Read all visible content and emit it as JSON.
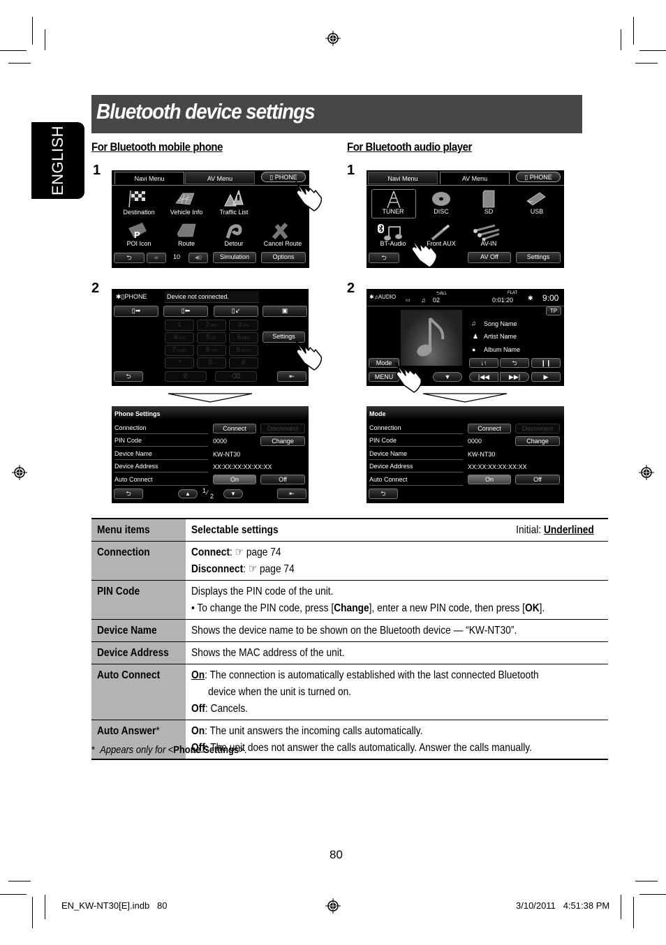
{
  "page": {
    "title": "Bluetooth device settings",
    "language_tab": "ENGLISH",
    "page_number": "80",
    "footer_left": "EN_KW-NT30[E].indb   80",
    "footer_right": "3/10/2011   4:51:38 PM",
    "colors": {
      "title_bar": "#474747",
      "menu_column": "#b3b3b3",
      "screen_bg": "#000000"
    }
  },
  "phone_section": {
    "heading": "For Bluetooth mobile phone",
    "step1": "1",
    "step2": "2",
    "navi_screen": {
      "tabs": [
        "Navi Menu",
        "AV Menu",
        "PHONE"
      ],
      "icons": [
        {
          "label": "Destination",
          "icon": "checkered-flag-icon"
        },
        {
          "label": "Vehicle Info",
          "icon": "map-pin-icon"
        },
        {
          "label": "Traffic List",
          "icon": "traffic-sign-icon"
        },
        {
          "label": "POI Icon",
          "icon": "poi-icon"
        },
        {
          "label": "Route",
          "icon": "route-map-icon"
        },
        {
          "label": "Detour",
          "icon": "detour-icon"
        },
        {
          "label": "Cancel Route",
          "icon": "cancel-route-icon"
        }
      ],
      "volume_value": "10",
      "bottom_buttons": [
        "Simulation",
        "Options"
      ]
    },
    "phone_screen": {
      "header": "PHONE",
      "status": "Device not connected.",
      "keypad": [
        [
          "1",
          ""
        ],
        [
          "2",
          "ABC"
        ],
        [
          "3",
          "DEF"
        ],
        [
          "4",
          "GHI"
        ],
        [
          "5",
          "JKL"
        ],
        [
          "6",
          "MNO"
        ],
        [
          "7",
          "PQRS"
        ],
        [
          "8",
          "TUV"
        ],
        [
          "9",
          "WXYZ"
        ],
        [
          "*",
          ""
        ],
        [
          "0",
          "+"
        ],
        [
          "#",
          ""
        ]
      ],
      "settings_button": "Settings"
    },
    "settings_screen": {
      "title": "Phone Settings",
      "rows": [
        {
          "label": "Connection"
        },
        {
          "label": "PIN Code",
          "value": "0000"
        },
        {
          "label": "Device Name",
          "value": "KW-NT30"
        },
        {
          "label": "Device Address",
          "value": "XX:XX:XX:XX:XX:XX"
        },
        {
          "label": "Auto Connect"
        }
      ],
      "connect": "Connect",
      "disconnect": "Disconnect",
      "change": "Change",
      "on": "On",
      "off": "Off",
      "page_current": "1",
      "page_total": "2"
    }
  },
  "audio_section": {
    "heading": "For Bluetooth audio player",
    "step1": "1",
    "step2": "2",
    "av_screen": {
      "tabs": [
        "Navi Menu",
        "AV Menu",
        "PHONE"
      ],
      "icons": [
        {
          "label": "TUNER",
          "icon": "antenna-tower-icon"
        },
        {
          "label": "DISC",
          "icon": "disc-icon"
        },
        {
          "label": "SD",
          "icon": "sd-card-icon"
        },
        {
          "label": "USB",
          "icon": "usb-drive-icon"
        },
        {
          "label": "BT-Audio",
          "icon": "bluetooth-music-icon"
        },
        {
          "label": "Front AUX",
          "icon": "aux-plug-icon"
        },
        {
          "label": "AV-IN",
          "icon": "rca-cable-icon"
        }
      ],
      "bottom_buttons": [
        "AV Off",
        "Settings"
      ]
    },
    "audio_screen": {
      "header": "AUDIO",
      "repeat_mode": "ALL",
      "track": "02",
      "eq": "FLAT",
      "elapsed": "0:01:20",
      "clock": "9:00",
      "tp": "TP",
      "song": "Song Name",
      "artist": "Artist Name",
      "album": "Album Name",
      "mode_button": "Mode",
      "menu_button": "MENU"
    },
    "settings_screen": {
      "title": "Mode",
      "rows": [
        {
          "label": "Connection"
        },
        {
          "label": "PIN Code",
          "value": "0000"
        },
        {
          "label": "Device Name",
          "value": "KW-NT30"
        },
        {
          "label": "Device Address",
          "value": "XX:XX:XX:XX:XX:XX"
        },
        {
          "label": "Auto Connect"
        }
      ],
      "connect": "Connect",
      "disconnect": "Disconnect",
      "change": "Change",
      "on": "On",
      "off": "Off"
    }
  },
  "table": {
    "header": {
      "col1": "Menu items",
      "col2": "Selectable settings",
      "initial_label": "Initial: ",
      "initial_value": "Underlined"
    },
    "rows": [
      {
        "item": "Connection",
        "lines": [
          {
            "bold": "Connect",
            "text": ": ☞ page 74"
          },
          {
            "bold": "Disconnect",
            "text": ": ☞ page 74"
          }
        ]
      },
      {
        "item": "PIN Code",
        "lines": [
          {
            "text": "Displays the PIN code of the unit."
          },
          {
            "pre": "•  To change the PIN code, press [",
            "bold": "Change",
            "mid": "], enter a new PIN code, then press [",
            "bold2": "OK",
            "post": "]."
          }
        ]
      },
      {
        "item": "Device Name",
        "lines": [
          {
            "text": "Shows the device name to be shown on the Bluetooth device — “KW-NT30”."
          }
        ]
      },
      {
        "item": "Device Address",
        "lines": [
          {
            "text": "Shows the MAC address of the unit."
          }
        ]
      },
      {
        "item": "Auto Connect",
        "lines": [
          {
            "bold": "On",
            "text": ": The connection is automatically established with the last connected Bluetooth"
          },
          {
            "text": "device when the unit is turned on."
          },
          {
            "bold": "Off",
            "text": ": Cancels."
          }
        ]
      },
      {
        "item": "Auto Answer",
        "asterisk": "*",
        "lines": [
          {
            "bold": "On",
            "text": ": The unit answers the incoming calls automatically."
          },
          {
            "bold": "Off",
            "text": ": The unit does not answer the calls automatically. Answer the calls manually."
          }
        ]
      }
    ],
    "footnote": {
      "mark": "*",
      "italic": "Appears only for",
      "lt": " <",
      "bold": "Phone Settings",
      "gt": ">."
    }
  }
}
